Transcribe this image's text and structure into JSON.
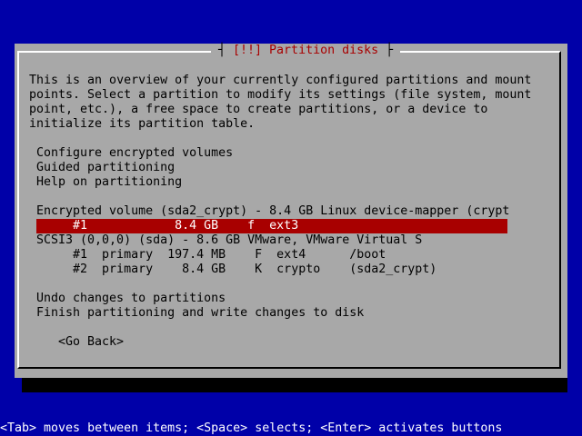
{
  "dialog": {
    "title_left": "┤ ",
    "title": "[!!] Partition disks",
    "title_right": " ├",
    "intro": [
      "This is an overview of your currently configured partitions and mount",
      "points. Select a partition to modify its settings (file system, mount",
      "point, etc.), a free space to create partitions, or a device to",
      "initialize its partition table."
    ],
    "menu": {
      "configure_encrypted": "Configure encrypted volumes",
      "guided": "Guided partitioning",
      "help": "Help on partitioning",
      "encrypted_device": "Encrypted volume (sda2_crypt) - 8.4 GB Linux device-mapper (crypt",
      "encrypted_part1": "     #1            8.4 GB    f  ext3",
      "scsi_device": "SCSI3 (0,0,0) (sda) - 8.6 GB VMware, VMware Virtual S",
      "scsi_part1": "     #1  primary  197.4 MB    F  ext4      /boot",
      "scsi_part2": "     #2  primary    8.4 GB    K  crypto    (sda2_crypt)",
      "undo": "Undo changes to partitions",
      "finish": "Finish partitioning and write changes to disk"
    },
    "go_back": "<Go Back>"
  },
  "help_bar": "<Tab> moves between items; <Space> selects; <Enter> activates buttons",
  "colors": {
    "background": "#0000a8",
    "dialog": "#a8a8a8",
    "selection": "#a80000",
    "title": "#a80000"
  }
}
